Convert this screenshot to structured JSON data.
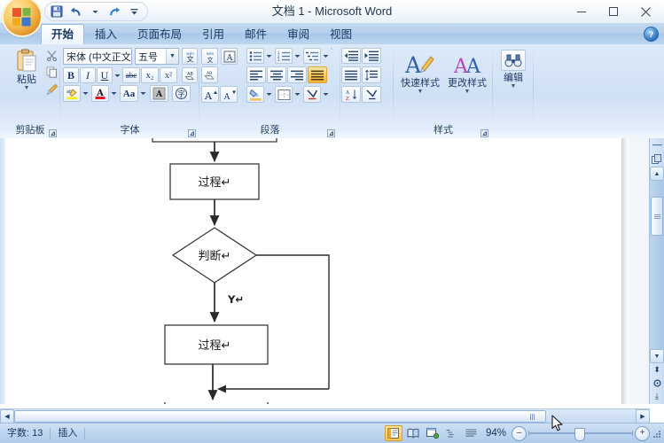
{
  "window": {
    "title": "文档 1 - Microsoft Word",
    "minimize_label": "–",
    "maximize_label": "▢",
    "close_label": "✕"
  },
  "quick_access": {
    "office_button": "office-orb",
    "save_label": "保存",
    "undo_label": "撤消",
    "redo_label": "恢复",
    "customize_label": "自定义快速访问工具栏"
  },
  "tabs": [
    {
      "label": "开始",
      "active": true
    },
    {
      "label": "插入",
      "active": false
    },
    {
      "label": "页面布局",
      "active": false
    },
    {
      "label": "引用",
      "active": false
    },
    {
      "label": "邮件",
      "active": false
    },
    {
      "label": "审阅",
      "active": false
    },
    {
      "label": "视图",
      "active": false
    }
  ],
  "help": {
    "label": "?"
  },
  "ribbon": {
    "groups": [
      {
        "name": "clipboard",
        "label": "剪贴板",
        "paste_label": "粘贴",
        "cut_label": "剪切",
        "copy_label": "复制",
        "format_painter_label": "格式刷"
      },
      {
        "name": "font",
        "label": "字体",
        "font_name": "宋体 (中文正文)",
        "font_size": "五号",
        "bold": "B",
        "italic": "I",
        "underline": "U",
        "strikethrough": "abc",
        "subscript": "x₂",
        "superscript": "x²",
        "grow_font": "A",
        "shrink_font": "A",
        "phonetic_guide": "wén",
        "char_border": "A",
        "clear_format": "清除格式",
        "highlight": "ab",
        "font_color": "A",
        "change_case": "Aa",
        "char_shading": "A",
        "enclose_char": "字"
      },
      {
        "name": "paragraph",
        "label": "段落",
        "bullets": "项目符号",
        "numbering": "编号",
        "multilevel": "多级列表",
        "decrease_indent": "减少缩进",
        "increase_indent": "增加缩进",
        "align_left": "左对齐",
        "align_center": "居中",
        "align_right": "右对齐",
        "justify": "两端对齐",
        "distribute": "分散对齐",
        "line_spacing": "行距",
        "shading": "底纹",
        "borders": "边框",
        "show_marks": "显示编辑标记",
        "sort": "排序"
      },
      {
        "name": "styles",
        "label": "样式",
        "quick_styles": "快速样式",
        "change_styles": "更改样式"
      },
      {
        "name": "editing",
        "label": "编辑",
        "find_label": "编辑"
      }
    ]
  },
  "document": {
    "flowchart": {
      "shapes": [
        {
          "id": "start",
          "type": "rounded-rect",
          "text": "",
          "clipped": true
        },
        {
          "id": "process1",
          "type": "rect",
          "text": "过程↵"
        },
        {
          "id": "decision",
          "type": "diamond",
          "text": "判断↵"
        },
        {
          "id": "branch_yes",
          "type": "label",
          "text": "Y↵"
        },
        {
          "id": "process2",
          "type": "rect",
          "text": "过程↵"
        },
        {
          "id": "process3",
          "type": "rect",
          "text": "",
          "clipped": true
        }
      ]
    }
  },
  "status": {
    "word_count": "字数: 13",
    "insert_mode": "插入",
    "zoom": "94%",
    "zoom_out": "–",
    "zoom_in": "+",
    "views": [
      {
        "name": "print-layout",
        "active": true
      },
      {
        "name": "full-screen-reading",
        "active": false
      },
      {
        "name": "web-layout",
        "active": false
      },
      {
        "name": "outline",
        "active": false
      },
      {
        "name": "draft",
        "active": false
      }
    ]
  },
  "colors": {
    "ribbon_blue": "#cfe0f5",
    "title_text": "#23384f",
    "accent_orange": "#f6b53f",
    "page_white": "#ffffff",
    "shape_stroke": "#3b3b3b"
  }
}
